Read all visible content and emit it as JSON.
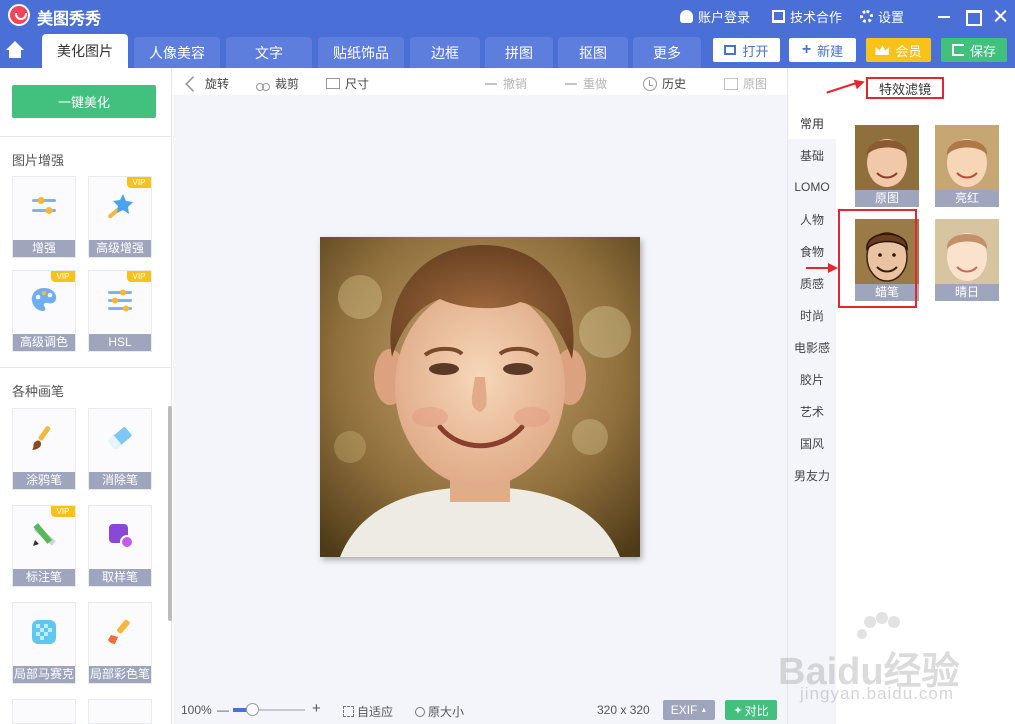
{
  "app": {
    "title": "美图秀秀"
  },
  "titlebar": {
    "account_label": "账户登录",
    "cooperation_label": "技术合作",
    "settings_label": "设置"
  },
  "tabs": [
    {
      "label": "美化图片",
      "active": true
    },
    {
      "label": "人像美容",
      "active": false
    },
    {
      "label": "文字",
      "active": false
    },
    {
      "label": "贴纸饰品",
      "active": false
    },
    {
      "label": "边框",
      "active": false
    },
    {
      "label": "拼图",
      "active": false
    },
    {
      "label": "抠图",
      "active": false
    },
    {
      "label": "更多",
      "active": false
    }
  ],
  "actions": {
    "open": "打开",
    "new": "新建",
    "vip": "会员",
    "save": "保存"
  },
  "left": {
    "onekey_label": "一键美化",
    "section_enhance": "图片增强",
    "section_brushes": "各种画笔",
    "vip_badge": "VIP",
    "tools": [
      {
        "label": "增强",
        "vip": false,
        "icon": "sliders-icon"
      },
      {
        "label": "高级增强",
        "vip": true,
        "icon": "magic-wand-icon"
      },
      {
        "label": "高级调色",
        "vip": true,
        "icon": "palette-icon"
      },
      {
        "label": "HSL",
        "vip": true,
        "icon": "hsl-sliders-icon"
      },
      {
        "label": "涂鸦笔",
        "vip": false,
        "icon": "paintbrush-icon"
      },
      {
        "label": "消除笔",
        "vip": false,
        "icon": "eraser-icon"
      },
      {
        "label": "标注笔",
        "vip": true,
        "icon": "pencil-ruler-icon"
      },
      {
        "label": "取样笔",
        "vip": false,
        "icon": "sample-pen-icon"
      },
      {
        "label": "局部马赛克",
        "vip": false,
        "icon": "mosaic-icon"
      },
      {
        "label": "局部彩色笔",
        "vip": false,
        "icon": "color-brush-icon"
      }
    ]
  },
  "edit_toolbar": {
    "rotate": "旋转",
    "crop": "裁剪",
    "size": "尺寸",
    "undo": "撤销",
    "redo": "重做",
    "history": "历史",
    "original": "原图"
  },
  "bottom": {
    "zoom_percent": "100%",
    "minus": "—",
    "plus": "+",
    "fit_label": "自适应",
    "actual_size_label": "原大小",
    "dimensions": "320 x 320",
    "exif_label": "EXIF",
    "compare_label": "对比"
  },
  "right": {
    "header": "特效滤镜",
    "categories": [
      "常用",
      "基础",
      "LOMO",
      "人物",
      "食物",
      "质感",
      "时尚",
      "电影感",
      "胶片",
      "艺术",
      "国风",
      "男友力"
    ],
    "active_category": "常用",
    "filters": [
      {
        "label": "原图",
        "style": "original"
      },
      {
        "label": "亮红",
        "style": "bright-red"
      },
      {
        "label": "蜡笔",
        "style": "crayon",
        "highlighted": true
      },
      {
        "label": "晴日",
        "style": "sunny"
      }
    ]
  },
  "watermark": {
    "brand": "Baidu经验",
    "url": "jingyan.baidu.com"
  },
  "colors": {
    "brand_blue": "#4a6fd6",
    "green": "#41c07e",
    "vip_gold": "#f8c21b",
    "highlight_red": "#e6262c"
  }
}
